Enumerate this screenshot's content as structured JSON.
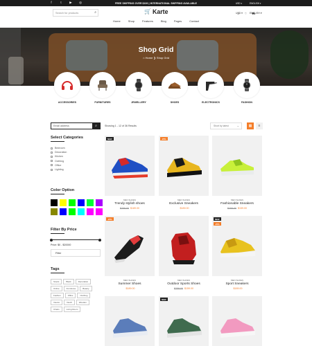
{
  "topbar": {
    "social": [
      "f",
      "t",
      "▶",
      "◎"
    ],
    "promo": "FREE SHIPPING OVER $100 | INTERNATIONAL SHIPPING AVAILABLE",
    "currency": "USD",
    "language": "ENGLISH"
  },
  "header": {
    "search_placeholder": "Search for products",
    "logo": "Karte"
  },
  "nav": [
    "Home",
    "Shop",
    "Features",
    "Blog",
    "Pages",
    "Contact"
  ],
  "hero": {
    "title": "Shop Grid",
    "crumb_home": "Home",
    "crumb_current": "Shop Grid"
  },
  "categories": [
    {
      "label": "ACCESSORIES",
      "icon": "headphones-icon"
    },
    {
      "label": "FURNITURES",
      "icon": "armchair-icon"
    },
    {
      "label": "JEWELLERY",
      "icon": "watch-icon"
    },
    {
      "label": "SHOES",
      "icon": "shoe-icon"
    },
    {
      "label": "ELECTRONICS",
      "icon": "drill-icon"
    },
    {
      "label": "FASHION",
      "icon": "watch-icon"
    }
  ],
  "sidebar": {
    "search_placeholder": "Email address",
    "categories_title": "Select Categories",
    "categories": [
      "Bedroom",
      "Decoration",
      "Kitchen",
      "Clothing",
      "Office",
      "Lighting"
    ],
    "color_title": "Color Option",
    "colors": [
      "#000000",
      "#ffff00",
      "#00ff00",
      "#0000ff",
      "#00ff33",
      "#aa00ff",
      "#888800",
      "#0000ff",
      "#00ff00",
      "#00ffff",
      "#ff00ff",
      "#ff00ff"
    ],
    "price_title": "Filter By Price",
    "price_text": "Price: $0 - $20000",
    "filter_label": "Filter",
    "tags_title": "Tags",
    "tags": [
      "Stools",
      "Black",
      "Decoration",
      "Online",
      "Furnitures",
      "Beauty",
      "Fashion",
      "Office",
      "Clothing",
      "Interior",
      "Devill",
      "Wooden",
      "Chairs",
      "Living Room"
    ]
  },
  "toolbar": {
    "showing": "Showing 1 - 12 of 36 Results",
    "sort": "Short by latest"
  },
  "products": [
    {
      "badge": "NEW",
      "badge_color": "#222222",
      "brand": "MEN SHOES",
      "title": "Trendy stylish shoes",
      "old": "$259.00",
      "price": "$189.00"
    },
    {
      "badge": "-25%",
      "badge_color": "#f47e2a",
      "brand": "MEN SHOES",
      "title": "Exclusive Sneakers",
      "old": "",
      "price": "$189.00"
    },
    {
      "badge": "",
      "badge_color": "",
      "brand": "MEN SHOES",
      "title": "Fashionable Sneakers",
      "old": "$259.00",
      "price": "$159.00"
    },
    {
      "badge": "-25%",
      "badge_color": "#f47e2a",
      "brand": "MEN SHOES",
      "title": "Summer Shoes",
      "old": "",
      "price": "$189.00"
    },
    {
      "badge": "",
      "badge_color": "",
      "brand": "MEN SHOES",
      "title": "Outdoor Sports Shoes",
      "old": "$259.00",
      "price": "$159.00"
    },
    {
      "badge": "NEW",
      "badge_color": "#222222",
      "badge2": "-25%",
      "brand": "MEN SHOES",
      "title": "Sport Sneakers",
      "old": "",
      "price": "$189.00"
    },
    {
      "badge": "",
      "badge_color": "",
      "brand": "",
      "title": "",
      "old": "",
      "price": ""
    },
    {
      "badge": "NEW",
      "badge_color": "#222222",
      "brand": "",
      "title": "",
      "old": "",
      "price": ""
    },
    {
      "badge": "",
      "badge_color": "",
      "brand": "",
      "title": "",
      "old": "",
      "price": ""
    }
  ]
}
